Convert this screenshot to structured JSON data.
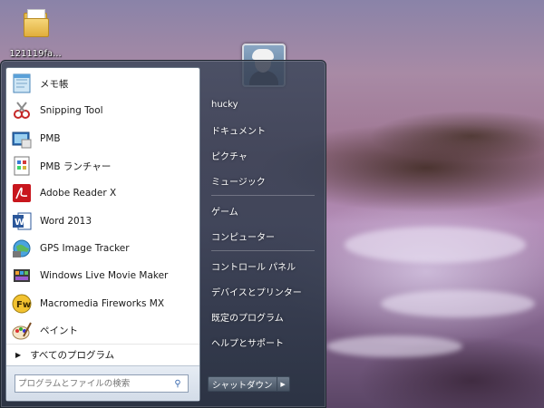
{
  "desktop": {
    "icon_label": "121119fa..."
  },
  "start_menu": {
    "programs": [
      {
        "label": "メモ帳",
        "icon": "notepad-icon"
      },
      {
        "label": "Snipping Tool",
        "icon": "snipping-tool-icon"
      },
      {
        "label": "PMB",
        "icon": "pmb-icon"
      },
      {
        "label": "PMB ランチャー",
        "icon": "pmb-launcher-icon"
      },
      {
        "label": "Adobe Reader X",
        "icon": "adobe-reader-icon"
      },
      {
        "label": "Word 2013",
        "icon": "word-icon"
      },
      {
        "label": "GPS Image Tracker",
        "icon": "gps-image-tracker-icon"
      },
      {
        "label": "Windows Live Movie Maker",
        "icon": "movie-maker-icon"
      },
      {
        "label": "Macromedia Fireworks MX",
        "icon": "fireworks-icon"
      },
      {
        "label": "ペイント",
        "icon": "paint-icon"
      }
    ],
    "all_programs": "すべてのプログラム",
    "search_placeholder": "プログラムとファイルの検索",
    "right": {
      "user": "hucky",
      "documents": "ドキュメント",
      "pictures": "ピクチャ",
      "music": "ミュージック",
      "games": "ゲーム",
      "computer": "コンピューター",
      "control_panel": "コントロール パネル",
      "devices": "デバイスとプリンター",
      "default_programs": "既定のプログラム",
      "help": "ヘルプとサポート"
    },
    "shutdown_label": "シャットダウン"
  }
}
